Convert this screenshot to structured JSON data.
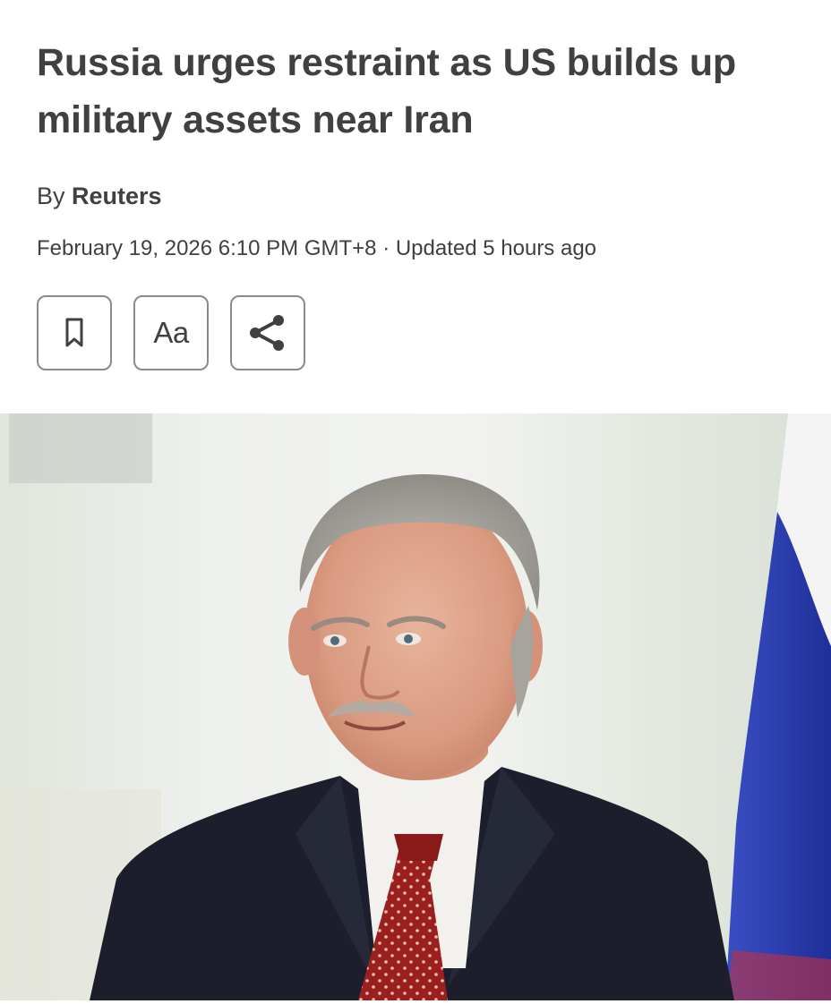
{
  "article": {
    "headline": "Russia urges restraint as US builds up military assets near Iran",
    "byline_prefix": "By",
    "author": "Reuters",
    "dateline": "February 19, 2026 6:10 PM GMT+8 · Updated 5 hours ago"
  },
  "actions": {
    "bookmark_icon": "bookmark-icon",
    "text_size_label": "Aa",
    "share_icon": "share-icon"
  },
  "hero_image": {
    "subject": "man-in-dark-suit-red-tie-portrait"
  },
  "colors": {
    "text": "#404040",
    "button_border": "#8a8a8a",
    "flag_blue": "#2a3db0",
    "tie_red": "#9c1f1f"
  }
}
